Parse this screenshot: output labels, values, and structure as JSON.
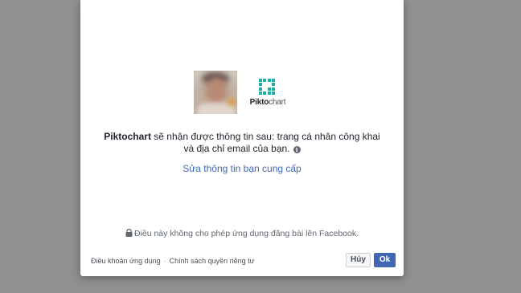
{
  "app": {
    "name": "Piktochart",
    "logo_text_bold": "Pikto",
    "logo_text_rest": "chart"
  },
  "permission": {
    "line1_after_name": " sẽ nhận được thông tin sau: trang cá nhân công khai",
    "line2": "và địa chỉ email của bạn.",
    "info_icon_glyph": "i"
  },
  "edit_link": "Sửa thông tin bạn cung cấp",
  "notice": "Điều này không cho phép ứng dụng đăng bài lên Facebook.",
  "footer": {
    "terms": "Điều khoản ứng dụng",
    "separator": "·",
    "privacy": "Chính sách quyền riêng tư"
  },
  "buttons": {
    "cancel": "Hủy",
    "ok": "Ok"
  },
  "colors": {
    "overlay": "#909090",
    "link": "#4267b2",
    "primary_button": "#4267b2",
    "logo_teal": "#1bb0a6"
  },
  "icons": [
    "lock-icon",
    "info-icon",
    "piktochart-logo-icon"
  ]
}
